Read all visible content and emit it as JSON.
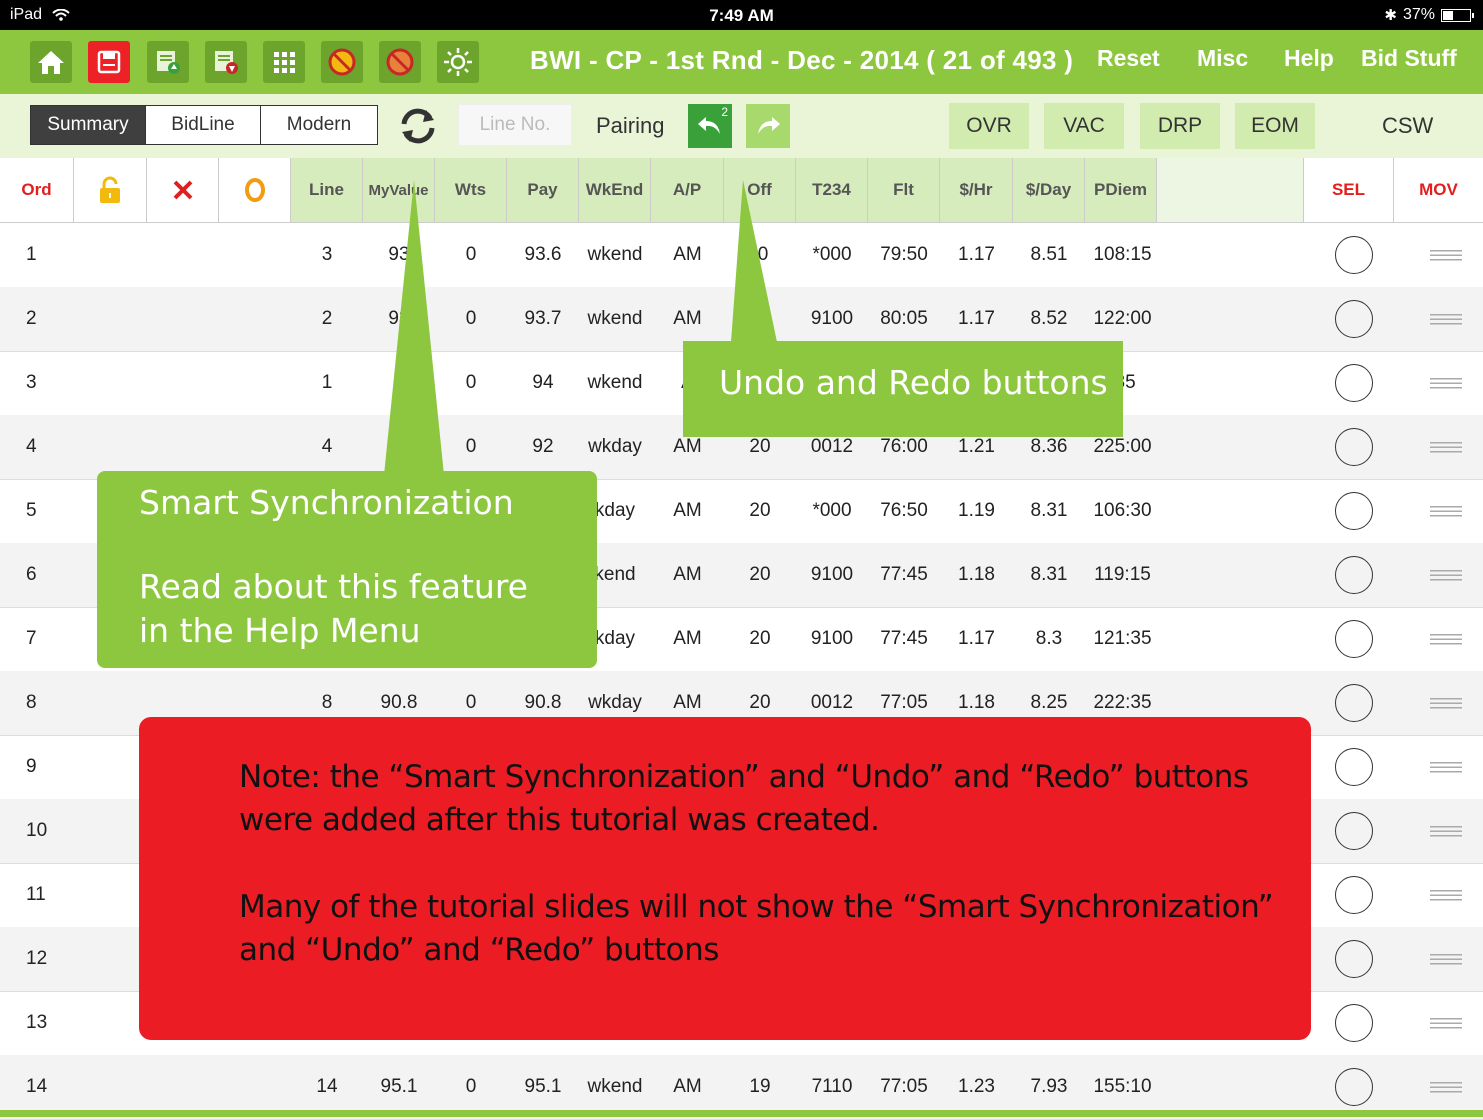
{
  "status_bar": {
    "device": "iPad",
    "time": "7:49 AM",
    "battery": "37%",
    "battery_level": 0.37
  },
  "top_bar": {
    "title": "BWI - CP - 1st Rnd - Dec - 2014 ( 21 of 493 )",
    "links": [
      "Reset",
      "Misc",
      "Help",
      "Bid Stuff"
    ],
    "icons": [
      "home-icon",
      "save-icon",
      "sheet-up-icon",
      "sheet-down-icon",
      "grid-icon",
      "no-lock-icon",
      "no-lock-alt-icon",
      "sun-icon"
    ],
    "colors": {
      "bar": "#8dc63f",
      "save": "#ec2227"
    }
  },
  "toolbar": {
    "tabs": [
      "Summary",
      "BidLine",
      "Modern"
    ],
    "active_tab": "Summary",
    "line_no_placeholder": "Line No.",
    "pairing_label": "Pairing",
    "undo_badge": "2",
    "vac_buttons": [
      "OVR",
      "VAC",
      "DRP",
      "EOM"
    ],
    "csw_label": "CSW"
  },
  "header": {
    "ord": "Ord",
    "columns": [
      "Line",
      "MyValue",
      "Wts",
      "Pay",
      "WkEnd",
      "A/P",
      "Off",
      "T234",
      "Flt",
      "$/Hr",
      "$/Day",
      "PDiem"
    ],
    "sel": "SEL",
    "mov": "MOV",
    "colors": {
      "red": "#e02020",
      "lock": "#f2b90f",
      "x": "#e02020",
      "o": "#f39c12"
    }
  },
  "rows": [
    {
      "ord": "1",
      "line": "3",
      "myvalue": "93",
      "wts": "0",
      "pay": "93.6",
      "wkend": "wkend",
      "ap": "AM",
      "off": "",
      "t234": "*000",
      "flt": "79:50",
      "hr": "1.17",
      "day": "8.51",
      "pdiem": "108:15"
    },
    {
      "ord": "2",
      "line": "2",
      "myvalue": "93",
      "wts": "0",
      "pay": "93.7",
      "wkend": "wkend",
      "ap": "AM",
      "off": "",
      "t234": "9100",
      "flt": "80:05",
      "hr": "1.17",
      "day": "8.52",
      "pdiem": "122:00"
    },
    {
      "ord": "3",
      "line": "1",
      "myvalue": "9",
      "wts": "0",
      "pay": "94",
      "wkend": "wkend",
      "ap": "A",
      "off": "",
      "t234": "",
      "flt": "",
      "hr": "",
      "day": "",
      "pdiem": ":35"
    },
    {
      "ord": "4",
      "line": "4",
      "myvalue": "",
      "wts": "0",
      "pay": "92",
      "wkend": "wkday",
      "ap": "AM",
      "off": "20",
      "t234": "0012",
      "flt": "76:00",
      "hr": "1.21",
      "day": "8.36",
      "pdiem": "225:00"
    },
    {
      "ord": "5",
      "line": "",
      "myvalue": "",
      "wts": "",
      "pay": "",
      "wkend": "kday",
      "ap": "AM",
      "off": "20",
      "t234": "*000",
      "flt": "76:50",
      "hr": "1.19",
      "day": "8.31",
      "pdiem": "106:30"
    },
    {
      "ord": "6",
      "line": "",
      "myvalue": "",
      "wts": "",
      "pay": "",
      "wkend": "kend",
      "ap": "AM",
      "off": "20",
      "t234": "9100",
      "flt": "77:45",
      "hr": "1.18",
      "day": "8.31",
      "pdiem": "119:15"
    },
    {
      "ord": "7",
      "line": "",
      "myvalue": "",
      "wts": "",
      "pay": "",
      "wkend": "kday",
      "ap": "AM",
      "off": "20",
      "t234": "9100",
      "flt": "77:45",
      "hr": "1.17",
      "day": "8.3",
      "pdiem": "121:35"
    },
    {
      "ord": "8",
      "line": "8",
      "myvalue": "90.8",
      "wts": "0",
      "pay": "90.8",
      "wkend": "wkday",
      "ap": "AM",
      "off": "20",
      "t234": "0012",
      "flt": "77:05",
      "hr": "1.18",
      "day": "8.25",
      "pdiem": "222:35"
    },
    {
      "ord": "9"
    },
    {
      "ord": "10"
    },
    {
      "ord": "11"
    },
    {
      "ord": "12"
    },
    {
      "ord": "13"
    },
    {
      "ord": "14",
      "line": "14",
      "myvalue": "95.1",
      "wts": "0",
      "pay": "95.1",
      "wkend": "wkend",
      "ap": "AM",
      "off": "19",
      "t234": "7110",
      "flt": "77:05",
      "hr": "1.23",
      "day": "7.93",
      "pdiem": "155:10"
    }
  ],
  "partial_off_row1": "0",
  "callouts": {
    "sync": [
      "Smart Synchronization",
      "Read about this feature",
      "in the Help Menu"
    ],
    "undo": "Undo and Redo buttons",
    "note": [
      "Note:  the “Smart Synchronization” and “Undo” and “Redo” buttons",
      "were added after this tutorial was created.",
      "Many of the tutorial slides will not show the “Smart Synchronization”",
      "and “Undo” and “Redo” buttons"
    ],
    "colors": {
      "green": "#8dc63f",
      "red": "#ec1c24"
    }
  }
}
